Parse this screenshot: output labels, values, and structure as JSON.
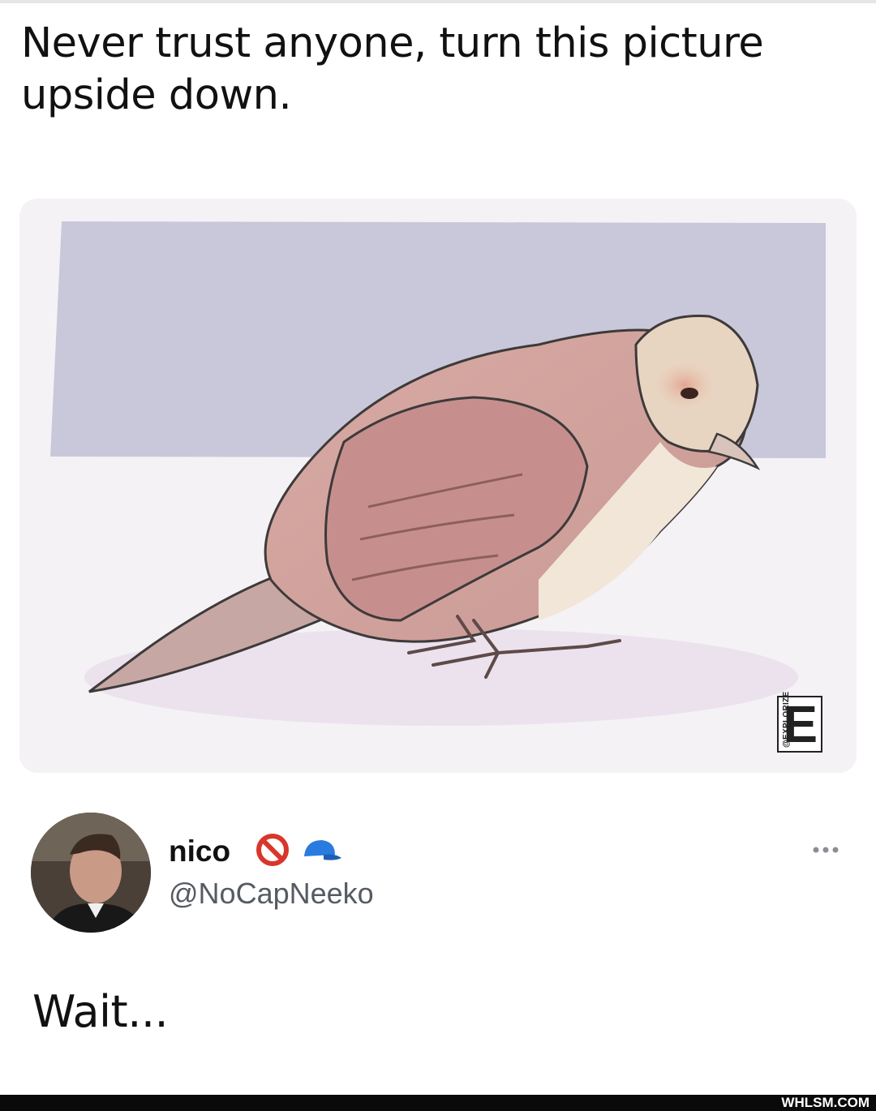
{
  "post": {
    "caption": "Never trust anyone, turn this picture upside down.",
    "watermark_vertical": "@EXPLORIZE",
    "watermark_letter": "E"
  },
  "tweet": {
    "name": "nico",
    "handle": "@NoCapNeeko",
    "text": "Wait...",
    "icons": [
      "prohibited-icon",
      "blue-cap-icon",
      "more-icon"
    ]
  },
  "footer": {
    "label": "WHLSM.COM"
  },
  "colors": {
    "prohibited": "#d9362b",
    "cap": "#2a7be0",
    "footer_bg": "#0a0a0a",
    "handle": "#555b63"
  }
}
